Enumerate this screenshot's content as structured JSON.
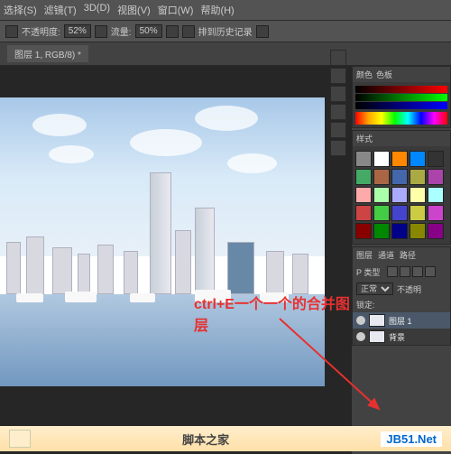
{
  "menu": {
    "items": [
      "选择(S)",
      "滤镜(T)",
      "3D(D)",
      "视图(V)",
      "窗口(W)",
      "帮助(H)"
    ]
  },
  "toolbar": {
    "opacity_label": "不透明度:",
    "opacity_value": "52%",
    "flow_label": "流量:",
    "flow_value": "50%",
    "history_label": "排到历史记录"
  },
  "document": {
    "tab_title": "图层 1, RGB/8) *"
  },
  "annotation": {
    "text": "ctrl+E一个一个的合并图层"
  },
  "panels": {
    "color": {
      "tabs": [
        "颜色",
        "色板"
      ]
    },
    "styles": {
      "tabs": [
        "样式"
      ]
    },
    "layers": {
      "tabs": [
        "图层",
        "通道",
        "路径"
      ],
      "filter_label": "P 类型",
      "blend_mode": "正常",
      "opacity_label": "不透明",
      "lock_label": "锁定:",
      "items": [
        {
          "name": "图层 1",
          "selected": true
        },
        {
          "name": "背景",
          "selected": false
        }
      ]
    }
  },
  "footer": {
    "brand": "脚本之家",
    "url": "JB51.Net"
  }
}
